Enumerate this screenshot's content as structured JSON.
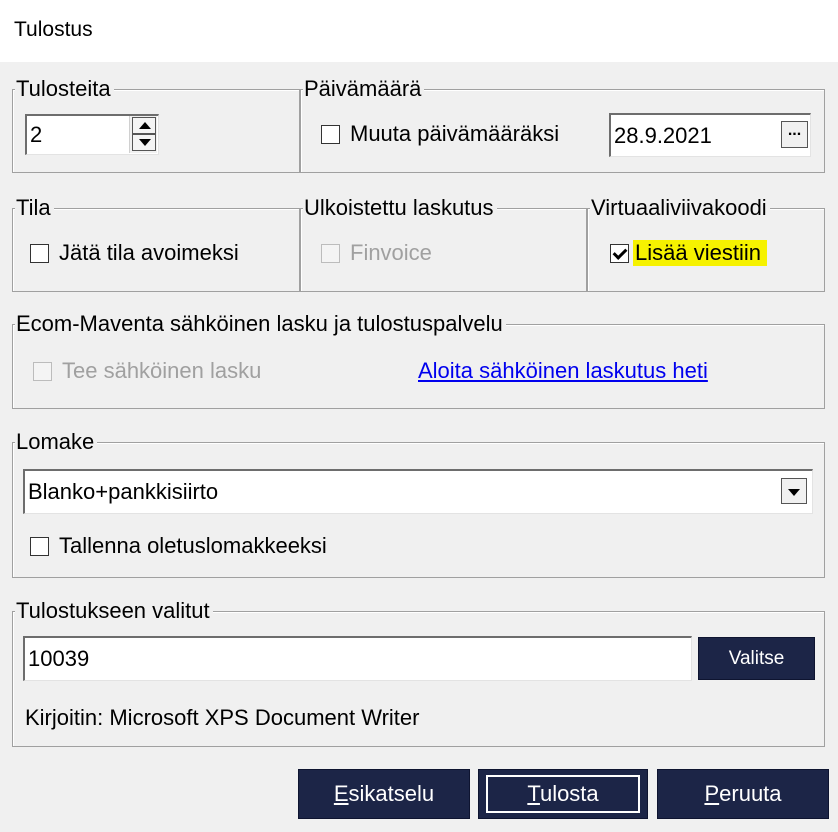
{
  "window": {
    "title": "Tulostus"
  },
  "tulosteita": {
    "label": "Tulosteita",
    "value": "2"
  },
  "paivamaara": {
    "label": "Päivämäärä",
    "checkbox_label": "Muuta päivämääräksi",
    "checked": false,
    "date_value": "28.9.2021",
    "browse_label": "..."
  },
  "tila": {
    "label": "Tila",
    "checkbox_label": "Jätä tila avoimeksi",
    "checked": false
  },
  "ulkoistettu": {
    "label": "Ulkoistettu laskutus",
    "checkbox_label": "Finvoice",
    "checked": false,
    "disabled": true
  },
  "virtuaali": {
    "label": "Virtuaaliviivakoodi",
    "checkbox_label": "Lisää viestiin",
    "checked": true,
    "highlight_color": "#f6f200"
  },
  "ecom": {
    "label": "Ecom-Maventa sähköinen lasku ja tulostuspalvelu",
    "checkbox_label": "Tee sähköinen lasku",
    "checked": false,
    "disabled": true,
    "link_text": "Aloita sähköinen laskutus heti"
  },
  "lomake": {
    "label": "Lomake",
    "selected": "Blanko+pankkisiirto",
    "checkbox_label": "Tallenna oletuslomakkeeksi",
    "checked": false
  },
  "valitut": {
    "label": "Tulostukseen valitut",
    "value": "10039",
    "button_label": "Valitse",
    "printer_text": "Kirjoitin: Microsoft XPS Document Writer"
  },
  "buttons": {
    "preview": "Esikatselu",
    "print": "Tulosta",
    "cancel": "Peruuta"
  },
  "colors": {
    "button_bg": "#1c2547",
    "link": "#0000ee",
    "window_bg": "#f0f0f0"
  }
}
